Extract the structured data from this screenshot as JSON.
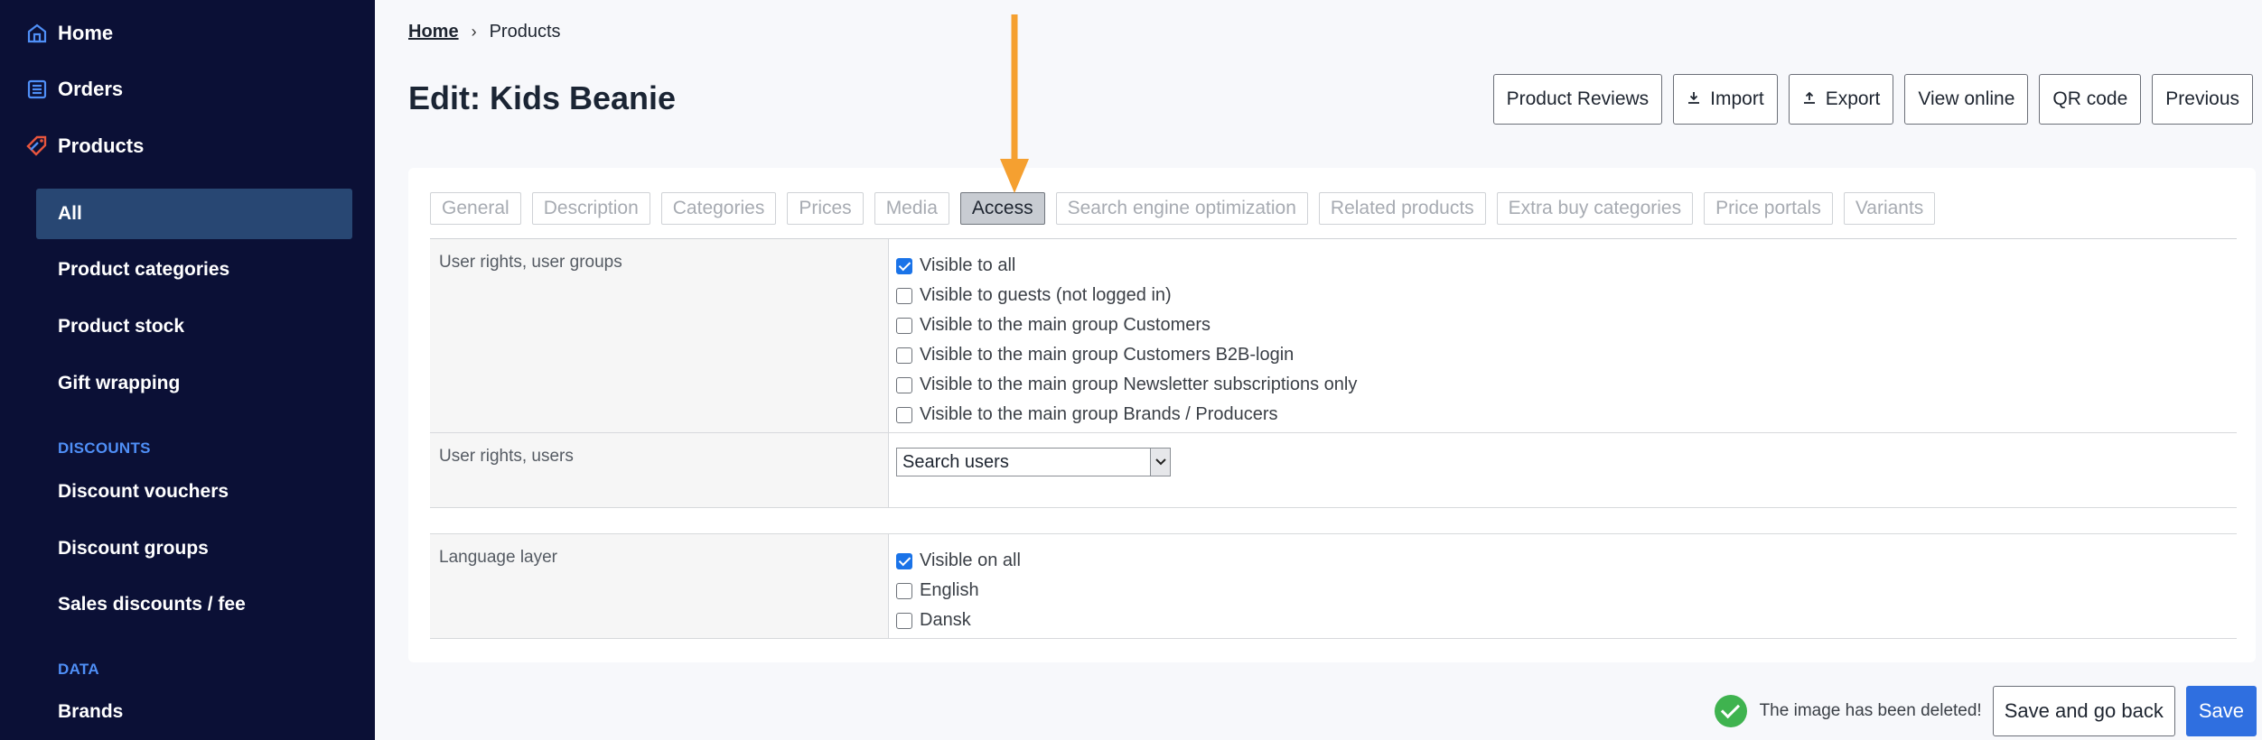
{
  "sidebar": {
    "top": [
      {
        "label": "Home",
        "icon": "home-icon"
      },
      {
        "label": "Orders",
        "icon": "list-icon"
      },
      {
        "label": "Products",
        "icon": "tag-icon"
      }
    ],
    "products_sub": [
      "All",
      "Product categories",
      "Product stock",
      "Gift wrapping"
    ],
    "discounts_title": "DISCOUNTS",
    "discounts": [
      "Discount vouchers",
      "Discount groups",
      "Sales discounts / fee"
    ],
    "data_title": "DATA",
    "data": [
      "Brands"
    ]
  },
  "breadcrumb": {
    "home": "Home",
    "sep": "›",
    "current": "Products"
  },
  "title": "Edit: Kids Beanie",
  "toolbar": {
    "reviews": "Product Reviews",
    "import": "Import",
    "export": "Export",
    "view_online": "View online",
    "qr": "QR code",
    "previous": "Previous"
  },
  "tabs": [
    "General",
    "Description",
    "Categories",
    "Prices",
    "Media",
    "Access",
    "Search engine optimization",
    "Related products",
    "Extra buy categories",
    "Price portals",
    "Variants"
  ],
  "access": {
    "user_groups_label": "User rights, user groups",
    "user_groups": [
      {
        "label": "Visible to all",
        "checked": true
      },
      {
        "label": "Visible to guests (not logged in)",
        "checked": false
      },
      {
        "label": "Visible to the main group Customers",
        "checked": false
      },
      {
        "label": "Visible to the main group Customers B2B-login",
        "checked": false
      },
      {
        "label": "Visible to the main group Newsletter subscriptions only",
        "checked": false
      },
      {
        "label": "Visible to the main group Brands / Producers",
        "checked": false
      }
    ],
    "users_label": "User rights, users",
    "users_select": "Search users",
    "language_label": "Language layer",
    "languages": [
      {
        "label": "Visible on all",
        "checked": true
      },
      {
        "label": "English",
        "checked": false
      },
      {
        "label": "Dansk",
        "checked": false
      }
    ]
  },
  "footer": {
    "notice": "The image has been deleted!",
    "save_back": "Save and go back",
    "save": "Save"
  },
  "colors": {
    "sidebar": "#0b1036",
    "accent": "#2f6fe0",
    "arrow": "#f5a030",
    "success": "#3fb34f"
  }
}
